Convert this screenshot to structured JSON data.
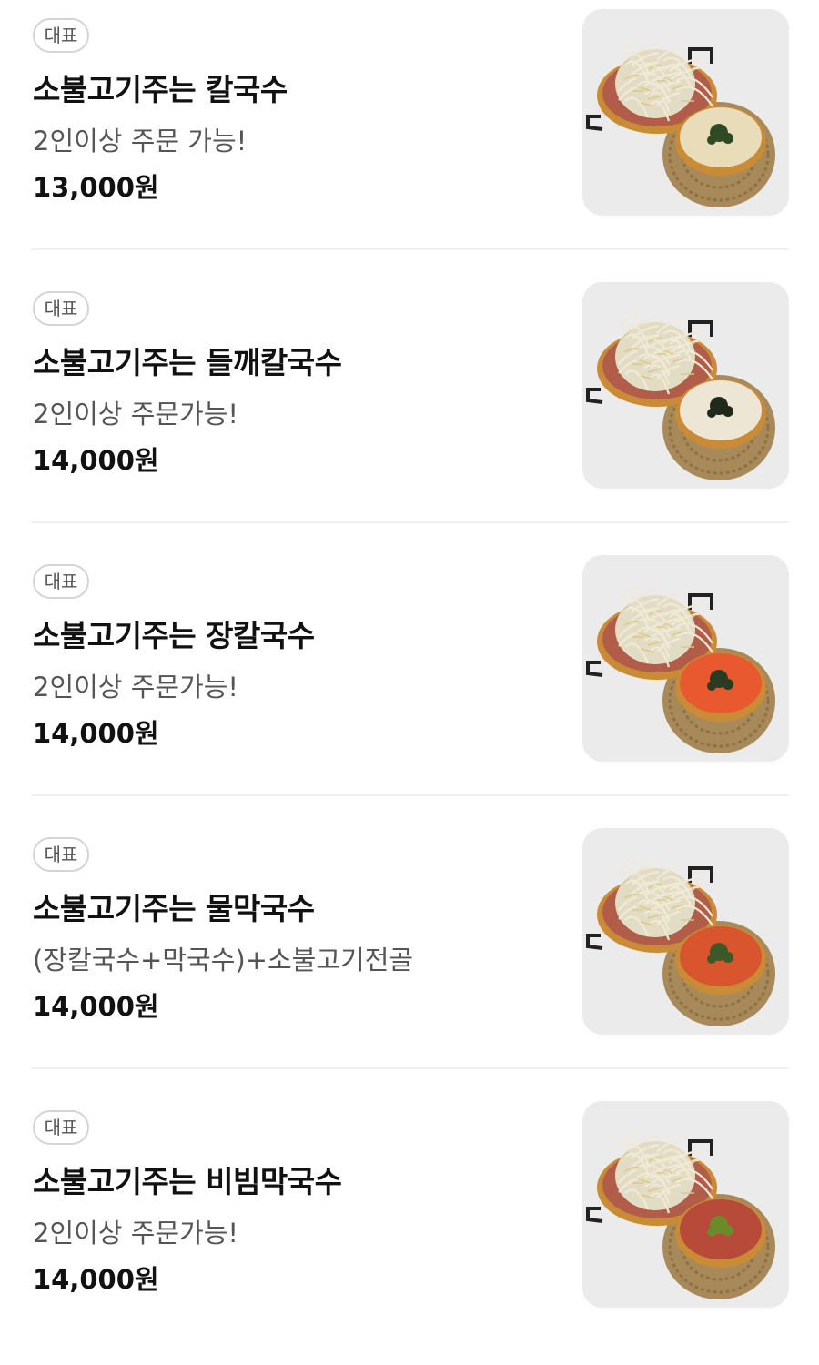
{
  "menu": {
    "items": [
      {
        "badge": "대표",
        "name": "소불고기주는 칼국수",
        "description": "2인이상 주문 가능!",
        "price": "13,000원",
        "soup_color": "#e9dcb8",
        "garnish_color": "#2f4a24"
      },
      {
        "badge": "대표",
        "name": "소불고기주는 들깨칼국수",
        "description": "2인이상 주문가능!",
        "price": "14,000원",
        "soup_color": "#ede6d4",
        "garnish_color": "#1f2a1c"
      },
      {
        "badge": "대표",
        "name": "소불고기주는 장칼국수",
        "description": "2인이상 주문가능!",
        "price": "14,000원",
        "soup_color": "#e8592f",
        "garnish_color": "#2a3b22"
      },
      {
        "badge": "대표",
        "name": "소불고기주는 물막국수",
        "description": "(장칼국수+막국수)+소불고기전골",
        "price": "14,000원",
        "soup_color": "#d8552e",
        "garnish_color": "#3a5a2a"
      },
      {
        "badge": "대표",
        "name": "소불고기주는 비빔막국수",
        "description": "2인이상 주문가능!",
        "price": "14,000원",
        "soup_color": "#b84a3a",
        "garnish_color": "#6b8a2a"
      }
    ]
  }
}
